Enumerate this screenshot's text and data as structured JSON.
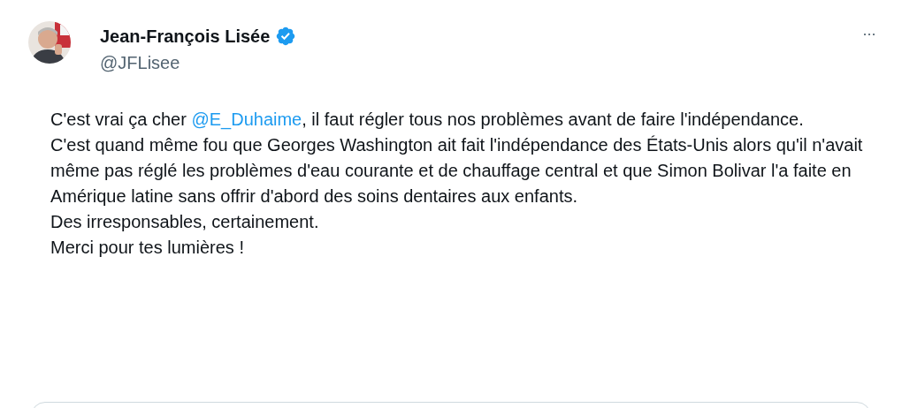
{
  "author": {
    "name": "Jean-François Lisée",
    "verified": true,
    "handle": "@JFLisee"
  },
  "more_button": "···",
  "body": {
    "first_paragraph": {
      "before": "C'est vrai ça cher ",
      "mention": "@E_Duhaime",
      "after": ", il faut régler tous nos problèmes avant de faire l'indépendance."
    },
    "paragraphs": [
      "C'est quand même fou que Georges Washington ait fait l'indépendance des États-Unis alors qu'il n'avait même pas réglé les problèmes d'eau courante et de chauffage central et que Simon Bolivar l'a faite en Amérique latine sans offrir d'abord des soins dentaires aux enfants.",
      "Des irresponsables, certainement.",
      "Merci pour tes lumières !"
    ]
  },
  "quoted_card": {
    "kind": "card"
  }
}
